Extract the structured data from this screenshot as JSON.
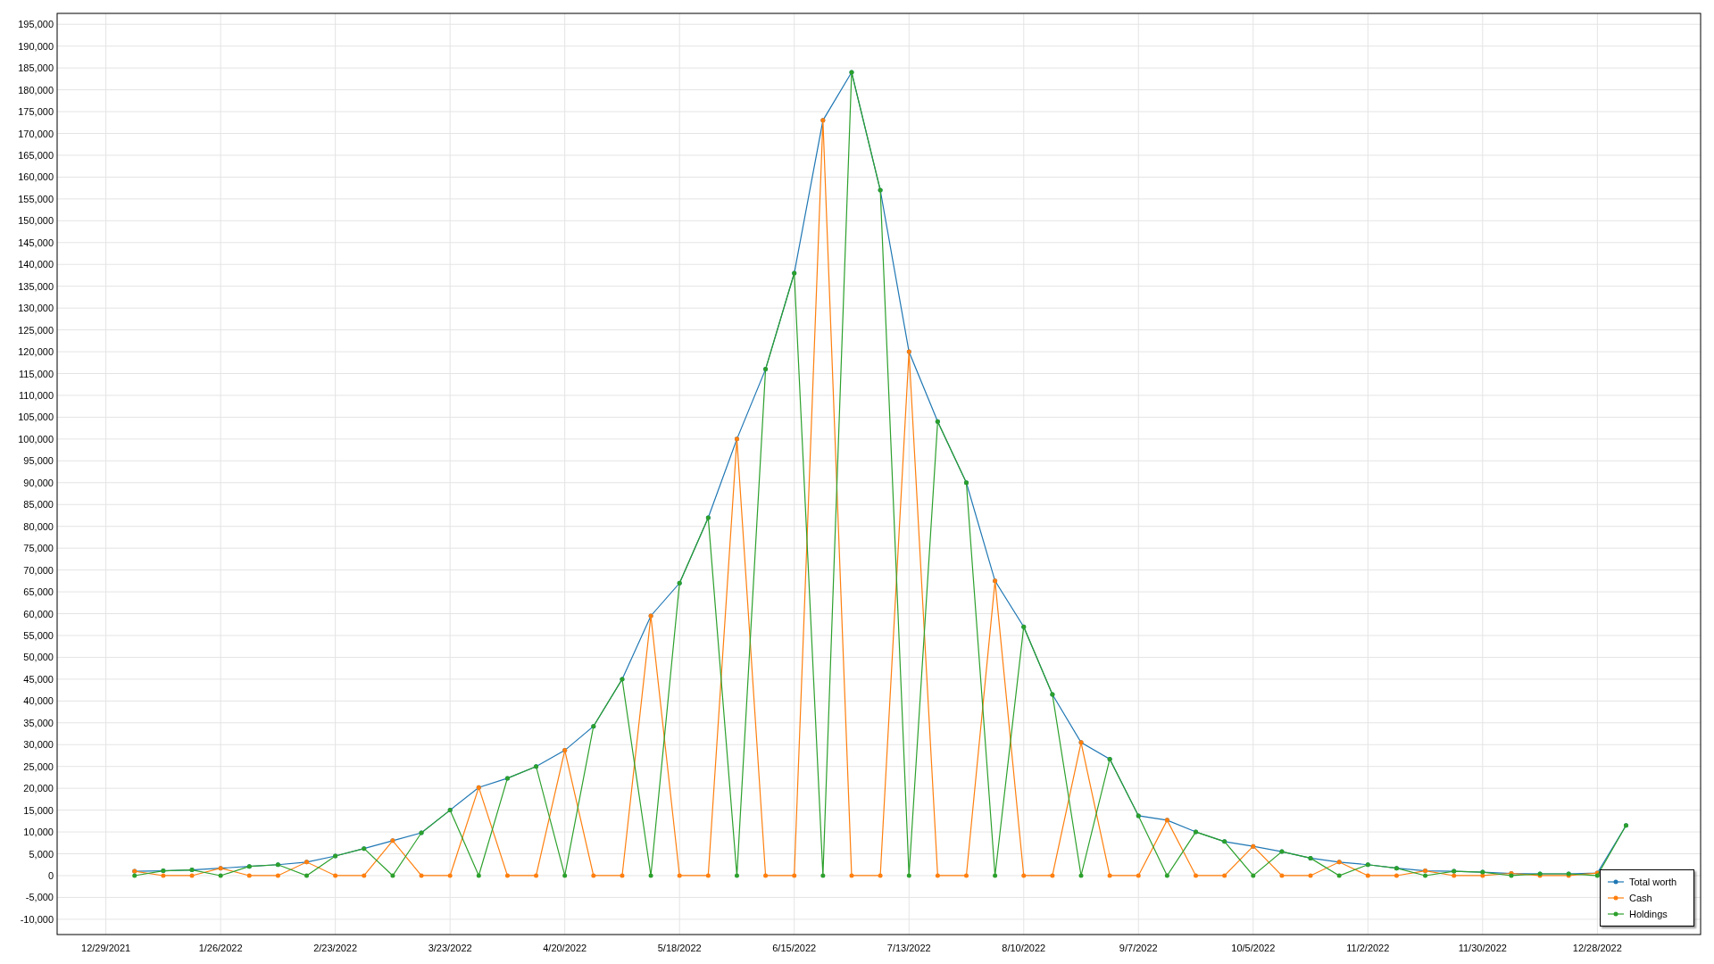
{
  "chart_data": {
    "type": "line",
    "grid": true,
    "categories": [
      "12/29/2021",
      null,
      null,
      null,
      "1/26/2022",
      null,
      null,
      null,
      "2/23/2022",
      null,
      null,
      null,
      "3/23/2022",
      null,
      null,
      null,
      "4/20/2022",
      null,
      null,
      null,
      "5/18/2022",
      null,
      null,
      null,
      "6/15/2022",
      null,
      null,
      null,
      "7/13/2022",
      null,
      null,
      null,
      "8/10/2022",
      null,
      null,
      null,
      "9/7/2022",
      null,
      null,
      null,
      "10/5/2022",
      null,
      null,
      null,
      "11/2/2022",
      null,
      null,
      null,
      "11/30/2022",
      null,
      null,
      null,
      "12/28/2022",
      null
    ],
    "series": [
      {
        "name": "Total worth",
        "color": "#1f77b4",
        "values": [
          null,
          1000,
          1100,
          1300,
          1700,
          2100,
          2500,
          3100,
          4500,
          6200,
          8000,
          9800,
          15000,
          20200,
          22300,
          25000,
          28700,
          34200,
          45000,
          59500,
          67000,
          82000,
          100000,
          116000,
          138000,
          173000,
          184000,
          157000,
          120000,
          104000,
          90000,
          67500,
          57000,
          41500,
          30500,
          26700,
          13700,
          12700,
          10000,
          7800,
          6700,
          5500,
          4000,
          3100,
          2500,
          1700,
          1100,
          1000,
          800,
          500,
          400,
          400,
          600,
          11500
        ]
      },
      {
        "name": "Cash",
        "color": "#ff7f0e",
        "values": [
          null,
          1000,
          0,
          0,
          1700,
          0,
          0,
          3100,
          0,
          0,
          8000,
          0,
          0,
          20200,
          0,
          0,
          28700,
          0,
          0,
          59500,
          0,
          0,
          100000,
          0,
          0,
          173000,
          0,
          0,
          120000,
          0,
          0,
          67500,
          0,
          0,
          30500,
          0,
          0,
          12700,
          0,
          0,
          6700,
          0,
          0,
          3100,
          0,
          0,
          1100,
          0,
          0,
          500,
          0,
          0,
          600,
          null
        ]
      },
      {
        "name": "Holdings",
        "color": "#2ca02c",
        "values": [
          null,
          0,
          1100,
          1300,
          0,
          2100,
          2500,
          0,
          4500,
          6200,
          0,
          9800,
          15000,
          0,
          22300,
          25000,
          0,
          34200,
          45000,
          0,
          67000,
          82000,
          0,
          116000,
          138000,
          0,
          184000,
          157000,
          0,
          104000,
          90000,
          0,
          57000,
          41500,
          0,
          26700,
          13700,
          0,
          10000,
          7800,
          0,
          5500,
          4000,
          0,
          2500,
          1700,
          0,
          1000,
          800,
          0,
          400,
          400,
          0,
          11500
        ]
      }
    ],
    "ylim": [
      -13500,
      197500
    ],
    "yticks": [
      {
        "value": -10000,
        "label": "-10,000"
      },
      {
        "value": -5000,
        "label": "-5,000"
      },
      {
        "value": 0,
        "label": "0"
      },
      {
        "value": 5000,
        "label": "5,000"
      },
      {
        "value": 10000,
        "label": "10,000"
      },
      {
        "value": 15000,
        "label": "15,000"
      },
      {
        "value": 20000,
        "label": "20,000"
      },
      {
        "value": 25000,
        "label": "25,000"
      },
      {
        "value": 30000,
        "label": "30,000"
      },
      {
        "value": 35000,
        "label": "35,000"
      },
      {
        "value": 40000,
        "label": "40,000"
      },
      {
        "value": 45000,
        "label": "45,000"
      },
      {
        "value": 50000,
        "label": "50,000"
      },
      {
        "value": 55000,
        "label": "55,000"
      },
      {
        "value": 60000,
        "label": "60,000"
      },
      {
        "value": 65000,
        "label": "65,000"
      },
      {
        "value": 70000,
        "label": "70,000"
      },
      {
        "value": 75000,
        "label": "75,000"
      },
      {
        "value": 80000,
        "label": "80,000"
      },
      {
        "value": 85000,
        "label": "85,000"
      },
      {
        "value": 90000,
        "label": "90,000"
      },
      {
        "value": 95000,
        "label": "95,000"
      },
      {
        "value": 100000,
        "label": "100,000"
      },
      {
        "value": 105000,
        "label": "105,000"
      },
      {
        "value": 110000,
        "label": "110,000"
      },
      {
        "value": 115000,
        "label": "115,000"
      },
      {
        "value": 120000,
        "label": "120,000"
      },
      {
        "value": 125000,
        "label": "125,000"
      },
      {
        "value": 130000,
        "label": "130,000"
      },
      {
        "value": 135000,
        "label": "135,000"
      },
      {
        "value": 140000,
        "label": "140,000"
      },
      {
        "value": 145000,
        "label": "145,000"
      },
      {
        "value": 150000,
        "label": "150,000"
      },
      {
        "value": 155000,
        "label": "155,000"
      },
      {
        "value": 160000,
        "label": "160,000"
      },
      {
        "value": 165000,
        "label": "165,000"
      },
      {
        "value": 170000,
        "label": "170,000"
      },
      {
        "value": 175000,
        "label": "175,000"
      },
      {
        "value": 180000,
        "label": "180,000"
      },
      {
        "value": 185000,
        "label": "185,000"
      },
      {
        "value": 190000,
        "label": "190,000"
      },
      {
        "value": 195000,
        "label": "195,000"
      }
    ]
  }
}
